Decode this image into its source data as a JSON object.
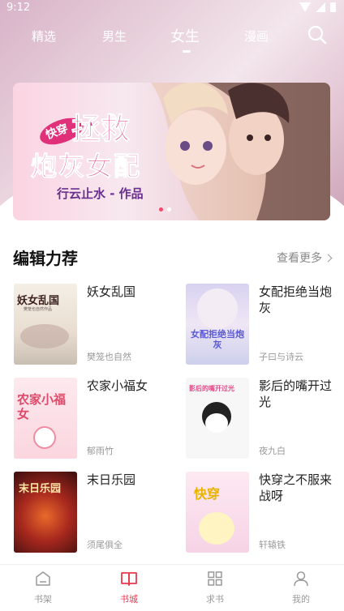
{
  "status": {
    "time": "9:12"
  },
  "top_tabs": [
    "精选",
    "男生",
    "女生",
    "漫画"
  ],
  "active_tab_index": 2,
  "banner": {
    "tag": "快穿",
    "title_line1": "拯救",
    "title_line2": "炮灰女配",
    "author_line": "行云止水 - 作品",
    "dots": 2,
    "active_dot": 0
  },
  "section": {
    "title": "编辑力荐",
    "more": "查看更多"
  },
  "books": [
    {
      "title": "妖女乱国",
      "author": "樊笼也自然",
      "cover_text": "妖女乱国",
      "cover_sub": "樊笼也自然作品"
    },
    {
      "title": "女配拒绝当炮灰",
      "author": "子曰与诗云",
      "cover_text": "女配拒绝当炮灰"
    },
    {
      "title": "农家小福女",
      "author": "郁雨竹",
      "cover_text": "农家小福女"
    },
    {
      "title": "影后的嘴开过光",
      "author": "夜九白",
      "cover_text": "影后的嘴开过光"
    },
    {
      "title": "末日乐园",
      "author": "须尾俱全",
      "cover_text": "末日乐园"
    },
    {
      "title": "快穿之不服来战呀",
      "author": "轩辕铁",
      "cover_text": "快穿"
    }
  ],
  "bottom_nav": [
    {
      "label": "书架",
      "icon": "bookshelf-icon"
    },
    {
      "label": "书城",
      "icon": "book-open-icon"
    },
    {
      "label": "求书",
      "icon": "grid-icon"
    },
    {
      "label": "我的",
      "icon": "user-icon"
    }
  ],
  "active_nav_index": 1,
  "colors": {
    "accent": "#e83a4f",
    "banner_title": "#e0307a",
    "muted": "#999999"
  }
}
